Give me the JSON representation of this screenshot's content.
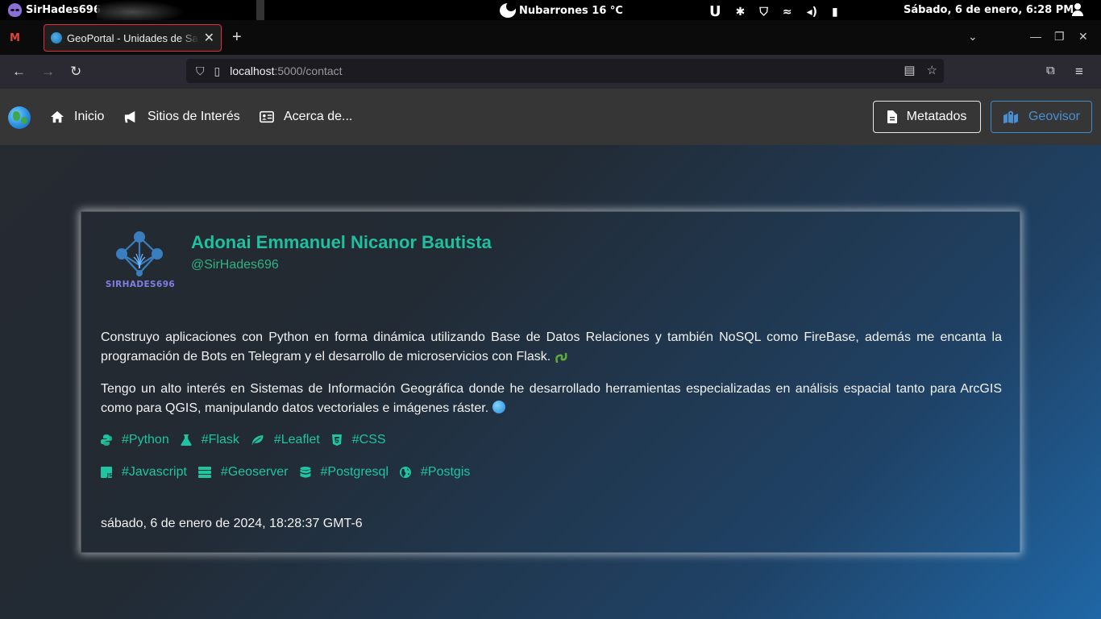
{
  "system_bar": {
    "user": "SirHades696",
    "weather": "Nubarrones 16 °C",
    "clock": "Sábado,  6 de enero,  6:28 PM"
  },
  "browser": {
    "tab_title": "GeoPortal - Unidades de Salud",
    "url_host": "localhost",
    "url_rest": ":5000/contact"
  },
  "site_nav": {
    "links": [
      "Inicio",
      "Sitios de Interés",
      "Acerca de..."
    ],
    "metadata_button": "Metatados",
    "viewer_button": "Geovisor"
  },
  "profile": {
    "logo_text": "SIRHADES696",
    "name": "Adonai Emmanuel Nicanor Bautista",
    "handle": "@SirHades696",
    "paragraph_1": "Construyo aplicaciones con Python en forma dinámica utilizando Base de Datos Relaciones y también NoSQL como FireBase, además me encanta la programación de Bots en Telegram y el desarrollo de microservicios con Flask.",
    "paragraph_2": "Tengo un alto interés en Sistemas de Información Geográfica donde he desarrollado herramientas especializadas en análisis espacial tanto para ArcGIS como para QGIS, manipulando datos vectoriales e imágenes ráster.",
    "tags_row_1": [
      "#Python",
      "#Flask",
      "#Leaflet",
      "#CSS"
    ],
    "tags_row_2": [
      "#Javascript",
      "#Geoserver",
      "#Postgresql",
      "#Postgis"
    ],
    "timestamp": "sábado, 6 de enero de 2024, 18:28:37 GMT-6"
  },
  "colors": {
    "accent_teal": "#1fbf9f",
    "geovisor_blue": "#4a8fd2",
    "tab_border": "#e0303a"
  }
}
